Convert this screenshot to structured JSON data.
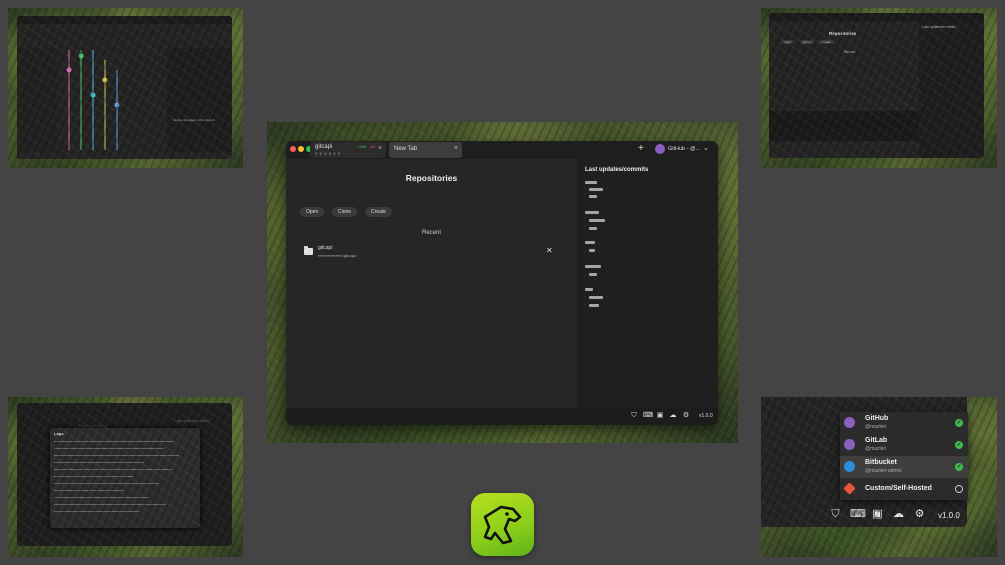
{
  "main_window": {
    "tabs": [
      {
        "title": "gitcapi",
        "sub": "⚲ ⚲ ⚲ ⚲ ⚲ ⚲",
        "additions": "+386",
        "deletions": "-26",
        "close": "×"
      },
      {
        "title": "New Tab",
        "close": "×"
      }
    ],
    "new_tab": "+",
    "account": {
      "label": "GitHub - @...",
      "chevron": "⌄"
    },
    "repositories_title": "Repositories",
    "buttons": {
      "open": "Open",
      "clone": "Clone",
      "create": "Create"
    },
    "recent_label": "Recent",
    "recent_items": [
      {
        "name": "gitcapi",
        "path": "▪▪▪▪▪▪▪▪▪▪▪▪▪▪▪/gitcapi",
        "remove": "✕"
      }
    ],
    "updates_title": "Last updates/commits",
    "version": "v1.0.0"
  },
  "thumbnails": {
    "top_right": {
      "title": "Repositories",
      "updates": "Last updates/commits",
      "recent": "Recent",
      "buttons": [
        "Open",
        "Clone",
        "Create"
      ]
    },
    "bottom_left": {
      "title": "Repositories",
      "log_title": "Logs",
      "updates": "Last updates/commits"
    },
    "top_left": {
      "no_changes": "No files changed in this commit"
    }
  },
  "account_menu": {
    "items": [
      {
        "name": "GitHub",
        "user": "@mazleri",
        "status": "connected",
        "check": "✓"
      },
      {
        "name": "GitLab",
        "user": "@mazleri",
        "status": "connected",
        "check": "✓"
      },
      {
        "name": "Bitbucket",
        "user": "@mazleri-admin",
        "status": "connected",
        "check": "✓"
      },
      {
        "name": "Custom/Self-Hosted",
        "user": "",
        "status": "none"
      }
    ],
    "version": "v1.0.0"
  },
  "icons": {
    "statusbar": [
      "briefcase-icon",
      "keyboard-icon",
      "terminal-icon",
      "cloud-icon",
      "gear-icon"
    ],
    "glyphs": {
      "briefcase": "⛉",
      "keyboard": "⌨",
      "terminal": "▣",
      "cloud": "☁",
      "gear": "⚙"
    }
  },
  "colors": {
    "background": "#444444",
    "window": "#262626",
    "accent_green": "#3fb950",
    "deletion_red": "#f85149",
    "logo_green": "#9bd61c"
  }
}
